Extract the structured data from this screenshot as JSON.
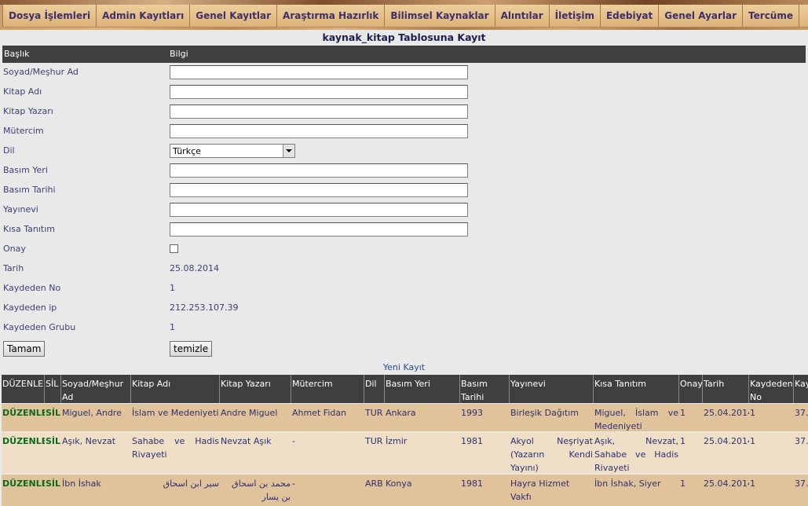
{
  "menu": [
    "Dosya İşlemleri",
    "Admin Kayıtları",
    "Genel Kayıtlar",
    "Araştırma Hazırlık",
    "Bilimsel Kaynaklar",
    "Alıntılar",
    "İletişim",
    "Edebiyat",
    "Genel Ayarlar",
    "Tercüme"
  ],
  "form": {
    "title": "kaynak_kitap Tablosuna Kayıt",
    "header_label": "Başlık",
    "header_value": "Bilgi",
    "fields": {
      "soyad_label": "Soyad/Meşhur Ad",
      "kitap_adi_label": "Kitap Adı",
      "kitap_yazari_label": "Kitap Yazarı",
      "mutercim_label": "Mütercim",
      "dil_label": "Dil",
      "dil_value": "Türkçe",
      "basim_yeri_label": "Basım Yeri",
      "basim_tarihi_label": "Basım Tarihi",
      "yayinevi_label": "Yayınevi",
      "kisa_tanitim_label": "Kısa Tanıtım",
      "onay_label": "Onay",
      "tarih_label": "Tarih",
      "tarih_value": "25.08.2014",
      "kaydeden_no_label": "Kaydeden No",
      "kaydeden_no_value": "1",
      "kaydeden_ip_label": "Kaydeden ip",
      "kaydeden_ip_value": "212.253.107.39",
      "kaydeden_grubu_label": "Kaydeden Grubu",
      "kaydeden_grubu_value": "1"
    },
    "submit_label": "Tamam",
    "reset_label": "temizle"
  },
  "list": {
    "title": "Yeni Kayıt",
    "columns": [
      "DÜZENLE",
      "SİL",
      "Soyad/Meşhur Ad",
      "Kitap Adı",
      "Kitap Yazarı",
      "Mütercim",
      "Dil",
      "Basım Yeri",
      "Basım Tarihi",
      "Yayınevi",
      "Kısa Tanıtım",
      "Onay",
      "Tarih",
      "Kaydeden No",
      "Kay"
    ],
    "rows": [
      {
        "duzenle": "DÜZENLE",
        "sil": "SİL",
        "soyad": "Miguel, Andre",
        "kitap_adi": "İslam ve Medeniyeti",
        "kitap_yazari": "Andre Miguel",
        "mutercim": "Ahmet Fidan",
        "dil": "TUR",
        "basim_yeri": "Ankara",
        "basim_tarihi": "1993",
        "yayinevi": "Birleşik Dağıtım",
        "kisa_tanitim": "Miguel, İslam ve Medeniyeti",
        "onay": "1",
        "tarih": "25.04.2014",
        "kaydeden_no": "1",
        "kay": "37."
      },
      {
        "duzenle": "DÜZENLE",
        "sil": "SİL",
        "soyad": "Aşık, Nevzat",
        "kitap_adi": "Sahabe ve Hadis Rivayeti",
        "kitap_yazari": "Nevzat Aşık",
        "mutercim": "-",
        "dil": "TUR",
        "basim_yeri": "İzmir",
        "basim_tarihi": "1981",
        "yayinevi": "Akyol Neşriyat (Yazarın Kendi Yayını)",
        "kisa_tanitim": "Aşık, Nevzat, Sahabe ve Hadis Rivayeti",
        "onay": "1",
        "tarih": "25.04.2014",
        "kaydeden_no": "1",
        "kay": "37."
      },
      {
        "duzenle": "DÜZENLE",
        "sil": "SİL",
        "soyad": "İbn İshak",
        "kitap_adi": "سیر ابن اسحاق",
        "kitap_yazari": "محمد بن اسحاق بن يسار",
        "mutercim": "-",
        "dil": "ARB",
        "basim_yeri": "Konya",
        "basim_tarihi": "1981",
        "yayinevi": "Hayra Hizmet Vakfı",
        "kisa_tanitim": "İbn İshak, Siyer",
        "onay": "1",
        "tarih": "25.04.2014",
        "kaydeden_no": "1",
        "kay": "37."
      }
    ]
  }
}
